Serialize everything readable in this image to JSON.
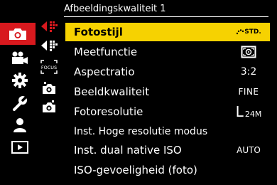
{
  "header": {
    "title": "Afbeeldingskwaliteit 1"
  },
  "categories": [
    {
      "icon": "camera-icon",
      "active": true
    },
    {
      "icon": "movie-camera-icon"
    },
    {
      "icon": "gear-icon"
    },
    {
      "icon": "wrench-icon"
    },
    {
      "icon": "person-icon"
    },
    {
      "icon": "playback-icon"
    }
  ],
  "subtabs": [
    {
      "icon": "quality-tab-1-icon",
      "active": true
    },
    {
      "icon": "quality-tab-2-icon"
    },
    {
      "icon": "focus-tab-icon",
      "text": "FOCUS"
    },
    {
      "icon": "camera-settings-tab-1-icon"
    },
    {
      "icon": "camera-settings-tab-2-icon"
    }
  ],
  "menu": {
    "items": [
      {
        "label": "Fotostijl",
        "value": "STD.",
        "selected": true
      },
      {
        "label": "Meetfunctie",
        "value": ""
      },
      {
        "label": "Aspectratio",
        "value": "3:2"
      },
      {
        "label": "Beeldkwaliteit",
        "value": "FINE"
      },
      {
        "label": "Fotoresolutie",
        "value": "L",
        "value_sub": "24M"
      },
      {
        "label": "Inst. Hoge resolutie modus",
        "value": ""
      },
      {
        "label": "Inst. dual native ISO",
        "value": "AUTO"
      },
      {
        "label": "ISO-gevoeligheid (foto)",
        "value": ""
      }
    ]
  },
  "colors": {
    "accent_red": "#d8191e",
    "highlight_yellow": "#f6d201"
  }
}
